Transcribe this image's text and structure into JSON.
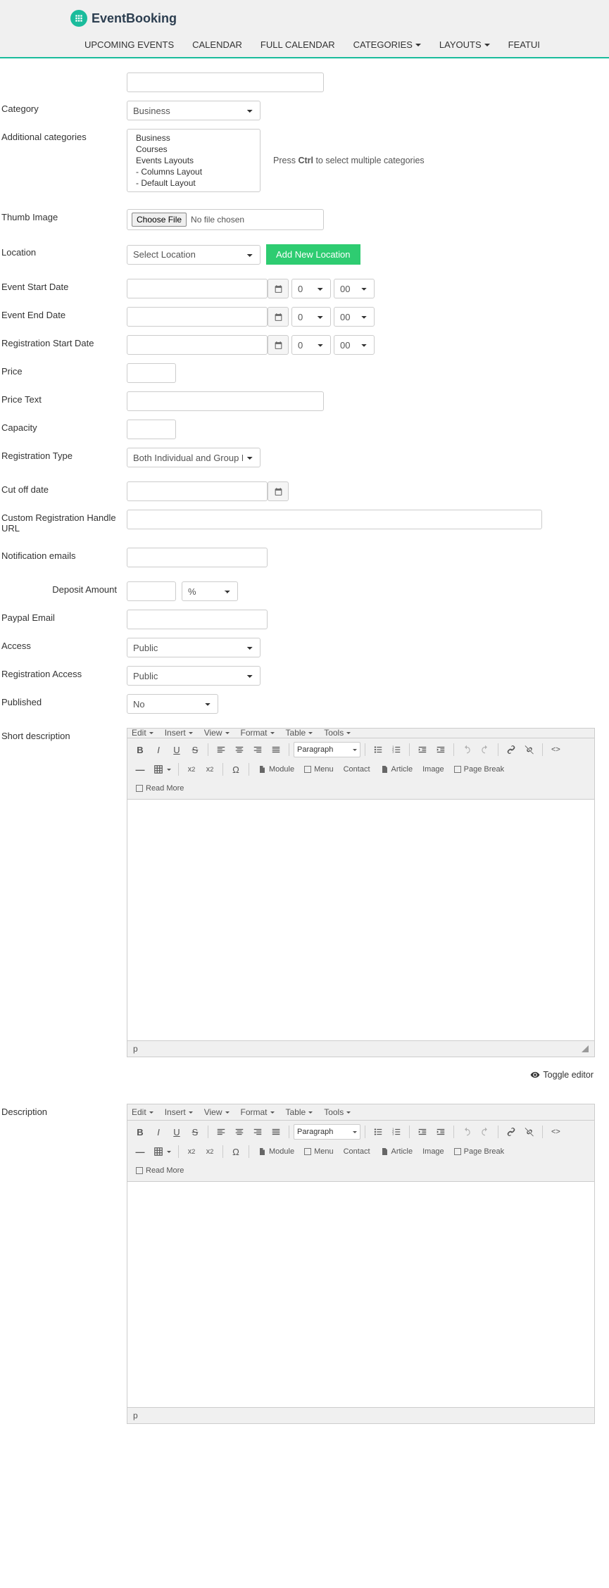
{
  "brand": {
    "name": "EventBooking"
  },
  "nav": {
    "upcoming": "UPCOMING EVENTS",
    "calendar": "CALENDAR",
    "full_calendar": "FULL CALENDAR",
    "categories": "CATEGORIES",
    "layouts": "LAYOUTS",
    "featured": "FEATUI"
  },
  "labels": {
    "category": "Category",
    "additional_categories": "Additional categories",
    "thumb_image": "Thumb Image",
    "location": "Location",
    "event_start": "Event Start Date",
    "event_end": "Event End Date",
    "reg_start": "Registration Start Date",
    "price": "Price",
    "price_text": "Price Text",
    "capacity": "Capacity",
    "reg_type": "Registration Type",
    "cutoff": "Cut off date",
    "custom_url": "Custom Registration Handle URL",
    "notif": "Notification emails",
    "deposit": "Deposit Amount",
    "paypal": "Paypal Email",
    "access": "Access",
    "reg_access": "Registration Access",
    "published": "Published",
    "short_desc": "Short description",
    "description": "Description"
  },
  "values": {
    "category": "Business",
    "location": "Select Location",
    "hour0": "0",
    "min00": "00",
    "reg_type": "Both Individual and Group Registration",
    "deposit_unit": "%",
    "access": "Public",
    "reg_access": "Public",
    "published": "No",
    "file_btn": "Choose File",
    "no_file": "No file chosen",
    "add_location": "Add New Location",
    "press_ctrl": "Press ",
    "ctrl_key": "Ctrl",
    "press_ctrl_after": " to select multiple categories"
  },
  "cats": {
    "business": "Business",
    "courses": "Courses",
    "events_layouts": "Events Layouts",
    "columns_layout": "- Columns Layout",
    "default_layout": "- Default Layout"
  },
  "editor": {
    "edit": "Edit",
    "insert": "Insert",
    "view": "View",
    "format": "Format",
    "table": "Table",
    "tools": "Tools",
    "paragraph": "Paragraph",
    "module": "Module",
    "menu": "Menu",
    "contact": "Contact",
    "article": "Article",
    "image": "Image",
    "pagebreak": "Page Break",
    "readmore": "Read More",
    "status_p": "p",
    "toggle": "Toggle editor"
  }
}
